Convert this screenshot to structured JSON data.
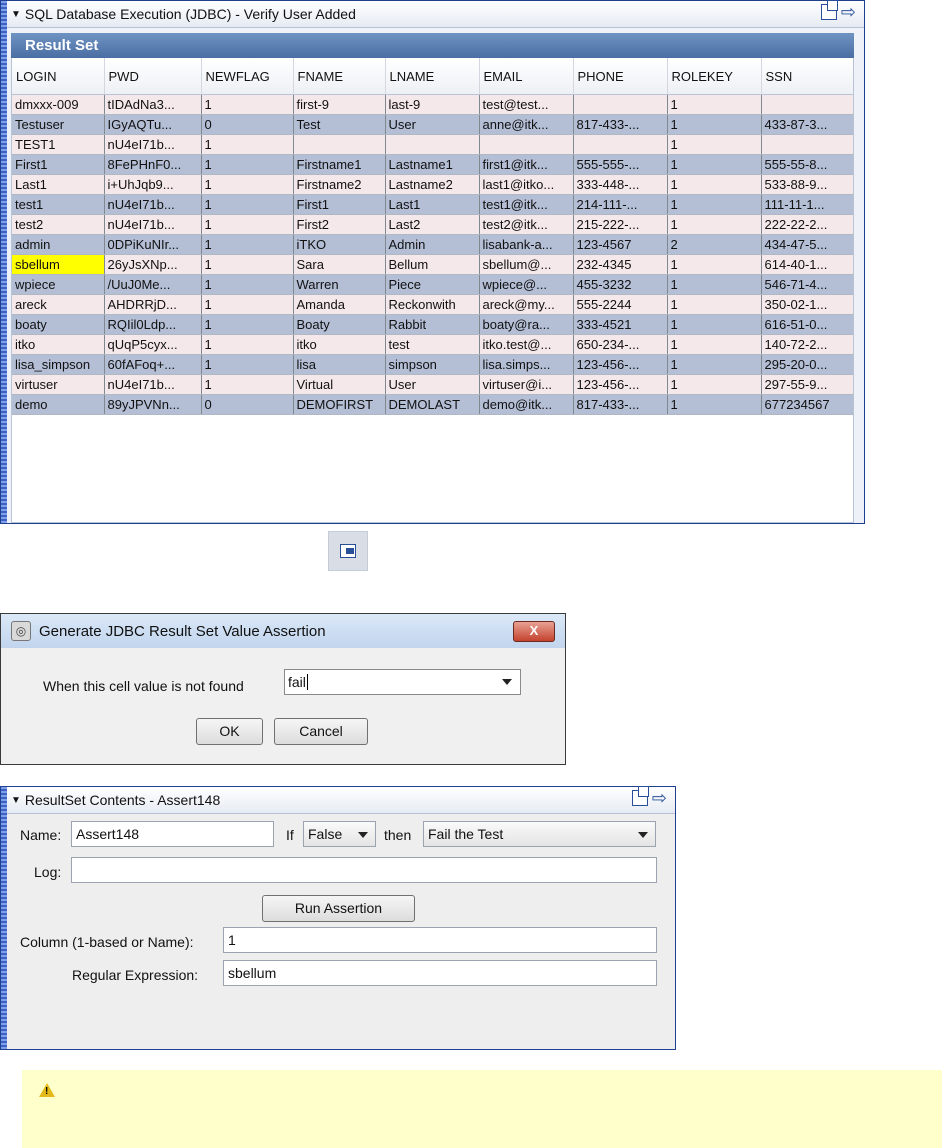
{
  "panel1": {
    "title": "SQL Database Execution (JDBC) - Verify User Added",
    "result_set_label": "Result Set",
    "columns": [
      "LOGIN",
      "PWD",
      "NEWFLAG",
      "FNAME",
      "LNAME",
      "EMAIL",
      "PHONE",
      "ROLEKEY",
      "SSN"
    ],
    "rows": [
      [
        "dmxxx-009",
        "tIDAdNa3...",
        "1",
        "first-9",
        "last-9",
        "test@test...",
        "",
        "1",
        ""
      ],
      [
        "Testuser",
        "IGyAQTu...",
        "0",
        "Test",
        "User",
        "anne@itk...",
        "817-433-...",
        "1",
        "433-87-3..."
      ],
      [
        "TEST1",
        "nU4eI71b...",
        "1",
        "",
        "",
        "",
        "",
        "1",
        ""
      ],
      [
        "First1",
        "8FePHnF0...",
        "1",
        "Firstname1",
        "Lastname1",
        "first1@itk...",
        "555-555-...",
        "1",
        "555-55-8..."
      ],
      [
        "Last1",
        "i+UhJqb9...",
        "1",
        "Firstname2",
        "Lastname2",
        "last1@itko...",
        "333-448-...",
        "1",
        "533-88-9..."
      ],
      [
        "test1",
        "nU4eI71b...",
        "1",
        "First1",
        "Last1",
        "test1@itk...",
        "214-111-...",
        "1",
        "111-11-1..."
      ],
      [
        "test2",
        "nU4eI71b...",
        "1",
        "First2",
        "Last2",
        "test2@itk...",
        "215-222-...",
        "1",
        "222-22-2..."
      ],
      [
        "admin",
        "0DPiKuNIr...",
        "1",
        "iTKO",
        "Admin",
        "lisabank-a...",
        "123-4567",
        "2",
        "434-47-5..."
      ],
      [
        "sbellum",
        "26yJsXNp...",
        "1",
        "Sara",
        "Bellum",
        "sbellum@...",
        "232-4345",
        "1",
        "614-40-1..."
      ],
      [
        "wpiece",
        "/UuJ0Me...",
        "1",
        "Warren",
        "Piece",
        "wpiece@...",
        "455-3232",
        "1",
        "546-71-4..."
      ],
      [
        "areck",
        "AHDRRjD...",
        "1",
        "Amanda",
        "Reckonwith",
        "areck@my...",
        "555-2244",
        "1",
        "350-02-1..."
      ],
      [
        "boaty",
        "RQIil0Ldp...",
        "1",
        "Boaty",
        "Rabbit",
        "boaty@ra...",
        "333-4521",
        "1",
        "616-51-0..."
      ],
      [
        "itko",
        "qUqP5cyx...",
        "1",
        "itko",
        "test",
        "itko.test@...",
        "650-234-...",
        "1",
        "140-72-2..."
      ],
      [
        "lisa_simpson",
        "60fAFoq+...",
        "1",
        "lisa",
        "simpson",
        "lisa.simps...",
        "123-456-...",
        "1",
        "295-20-0..."
      ],
      [
        "virtuser",
        "nU4eI71b...",
        "1",
        "Virtual",
        "User",
        "virtuser@i...",
        "123-456-...",
        "1",
        "297-55-9..."
      ],
      [
        "demo",
        "89yJPVNn...",
        "0",
        "DEMOFIRST",
        "DEMOLAST",
        "demo@itk...",
        "817-433-...",
        "1",
        "677234567"
      ]
    ],
    "selected_cell": {
      "row": 8,
      "col": 0
    }
  },
  "dialog": {
    "title": "Generate JDBC Result Set Value Assertion",
    "close_label": "X",
    "prompt": "When this cell value is not found",
    "combo_value": "fail",
    "ok_label": "OK",
    "cancel_label": "Cancel"
  },
  "panel2": {
    "title": "ResultSet Contents - Assert148",
    "name_label": "Name:",
    "name_value": "Assert148",
    "if_label": "If",
    "if_value": "False",
    "then_label": "then",
    "then_value": "Fail the Test",
    "log_label": "Log:",
    "log_value": "",
    "run_label": "Run Assertion",
    "column_label": "Column (1-based or Name):",
    "column_value": "1",
    "regex_label": "Regular Expression:",
    "regex_value": "sbellum"
  },
  "icons": {
    "collapse": "collapse-triangle-icon",
    "float": "float-window-icon",
    "dock": "dock-arrow-icon",
    "generate": "generate-assertion-icon",
    "warning": "warning-icon"
  },
  "colors": {
    "row_odd": "#f5e8ea",
    "row_even": "#b4bfd6",
    "selected": "#ffff00",
    "note_bg": "#ffffcc",
    "header_bar": "#4a6ea3"
  }
}
